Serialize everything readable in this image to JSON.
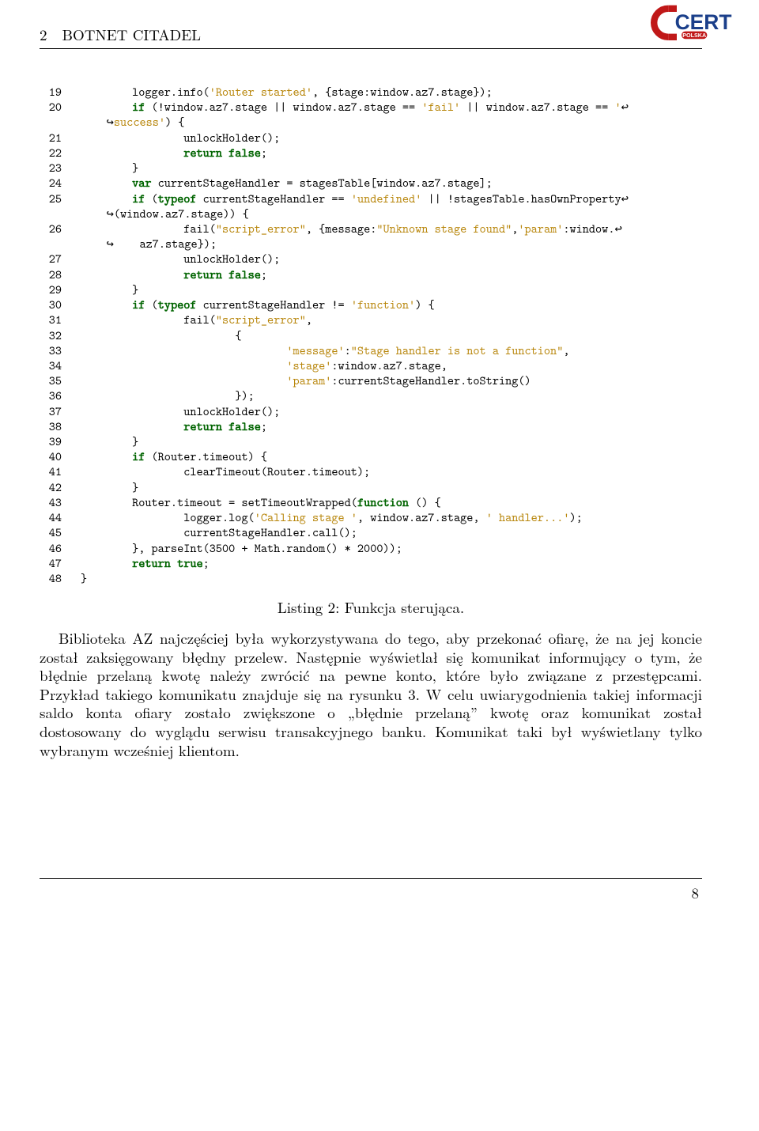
{
  "header": {
    "section_number": "2",
    "section_title": "BOTNET CITADEL",
    "logo_text_main": "CERT",
    "logo_text_sub": "POLSKA"
  },
  "code": {
    "lines": [
      {
        "n": 19,
        "seg": [
          [
            "id",
            "        logger.info("
          ],
          [
            "str",
            "'Router started'"
          ],
          [
            "id",
            ", {stage:window.az7.stage});"
          ]
        ]
      },
      {
        "n": 20,
        "seg": [
          [
            "id",
            "        "
          ],
          [
            "kw",
            "if"
          ],
          [
            "id",
            " (!window.az7.stage || window.az7.stage == "
          ],
          [
            "str",
            "'fail'"
          ],
          [
            "id",
            " || window.az7.stage == "
          ],
          [
            "str",
            "'"
          ]
        ],
        "wrap": true
      },
      {
        "n": 0,
        "cont": true,
        "seg": [
          [
            "str",
            "success'"
          ],
          [
            "id",
            ") {"
          ]
        ]
      },
      {
        "n": 21,
        "seg": [
          [
            "id",
            "                unlockHolder();"
          ]
        ]
      },
      {
        "n": 22,
        "seg": [
          [
            "id",
            "                "
          ],
          [
            "kw",
            "return"
          ],
          [
            "id",
            " "
          ],
          [
            "kw",
            "false"
          ],
          [
            "id",
            ";"
          ]
        ]
      },
      {
        "n": 23,
        "seg": [
          [
            "id",
            "        }"
          ]
        ]
      },
      {
        "n": 24,
        "seg": [
          [
            "id",
            "        "
          ],
          [
            "kw",
            "var"
          ],
          [
            "id",
            " currentStageHandler = stagesTable[window.az7.stage];"
          ]
        ]
      },
      {
        "n": 25,
        "seg": [
          [
            "id",
            "        "
          ],
          [
            "kw",
            "if"
          ],
          [
            "id",
            " ("
          ],
          [
            "kw",
            "typeof"
          ],
          [
            "id",
            " currentStageHandler == "
          ],
          [
            "str",
            "'undefined'"
          ],
          [
            "id",
            " || !stagesTable.hasOwnProperty"
          ]
        ],
        "wrap": true
      },
      {
        "n": 0,
        "cont": true,
        "seg": [
          [
            "id",
            "(window.az7.stage)) {"
          ]
        ]
      },
      {
        "n": 26,
        "seg": [
          [
            "id",
            "                fail("
          ],
          [
            "str",
            "\"script_error\""
          ],
          [
            "id",
            ", {message:"
          ],
          [
            "str",
            "\"Unknown stage found\""
          ],
          [
            "id",
            ","
          ],
          [
            "str",
            "'param'"
          ],
          [
            "id",
            ":window."
          ]
        ],
        "wrap": true
      },
      {
        "n": 0,
        "cont": true,
        "seg": [
          [
            "id",
            "    az7.stage});"
          ]
        ]
      },
      {
        "n": 27,
        "seg": [
          [
            "id",
            "                unlockHolder();"
          ]
        ]
      },
      {
        "n": 28,
        "seg": [
          [
            "id",
            "                "
          ],
          [
            "kw",
            "return"
          ],
          [
            "id",
            " "
          ],
          [
            "kw",
            "false"
          ],
          [
            "id",
            ";"
          ]
        ]
      },
      {
        "n": 29,
        "seg": [
          [
            "id",
            "        }"
          ]
        ]
      },
      {
        "n": 30,
        "seg": [
          [
            "id",
            "        "
          ],
          [
            "kw",
            "if"
          ],
          [
            "id",
            " ("
          ],
          [
            "kw",
            "typeof"
          ],
          [
            "id",
            " currentStageHandler != "
          ],
          [
            "str",
            "'function'"
          ],
          [
            "id",
            ") {"
          ]
        ]
      },
      {
        "n": 31,
        "seg": [
          [
            "id",
            "                fail("
          ],
          [
            "str",
            "\"script_error\""
          ],
          [
            "id",
            ","
          ]
        ]
      },
      {
        "n": 32,
        "seg": [
          [
            "id",
            "                        {"
          ]
        ]
      },
      {
        "n": 33,
        "seg": [
          [
            "id",
            "                                "
          ],
          [
            "str",
            "'message'"
          ],
          [
            "id",
            ":"
          ],
          [
            "str",
            "\"Stage handler is not a function\""
          ],
          [
            "id",
            ","
          ]
        ]
      },
      {
        "n": 34,
        "seg": [
          [
            "id",
            "                                "
          ],
          [
            "str",
            "'stage'"
          ],
          [
            "id",
            ":window.az7.stage,"
          ]
        ]
      },
      {
        "n": 35,
        "seg": [
          [
            "id",
            "                                "
          ],
          [
            "str",
            "'param'"
          ],
          [
            "id",
            ":currentStageHandler.toString()"
          ]
        ]
      },
      {
        "n": 36,
        "seg": [
          [
            "id",
            "                        });"
          ]
        ]
      },
      {
        "n": 37,
        "seg": [
          [
            "id",
            "                unlockHolder();"
          ]
        ]
      },
      {
        "n": 38,
        "seg": [
          [
            "id",
            "                "
          ],
          [
            "kw",
            "return"
          ],
          [
            "id",
            " "
          ],
          [
            "kw",
            "false"
          ],
          [
            "id",
            ";"
          ]
        ]
      },
      {
        "n": 39,
        "seg": [
          [
            "id",
            "        }"
          ]
        ]
      },
      {
        "n": 40,
        "seg": [
          [
            "id",
            "        "
          ],
          [
            "kw",
            "if"
          ],
          [
            "id",
            " (Router.timeout) {"
          ]
        ]
      },
      {
        "n": 41,
        "seg": [
          [
            "id",
            "                clearTimeout(Router.timeout);"
          ]
        ]
      },
      {
        "n": 42,
        "seg": [
          [
            "id",
            "        }"
          ]
        ]
      },
      {
        "n": 43,
        "seg": [
          [
            "id",
            "        Router.timeout = setTimeoutWrapped("
          ],
          [
            "kw",
            "function"
          ],
          [
            "id",
            " () {"
          ]
        ]
      },
      {
        "n": 44,
        "seg": [
          [
            "id",
            "                logger.log("
          ],
          [
            "str",
            "'Calling stage '"
          ],
          [
            "id",
            ", window.az7.stage, "
          ],
          [
            "str",
            "' handler...'"
          ],
          [
            "id",
            ");"
          ]
        ]
      },
      {
        "n": 45,
        "seg": [
          [
            "id",
            "                currentStageHandler.call();"
          ]
        ]
      },
      {
        "n": 46,
        "seg": [
          [
            "id",
            "        }, parseInt(3500 + Math.random() * 2000));"
          ]
        ]
      },
      {
        "n": 47,
        "seg": [
          [
            "id",
            "        "
          ],
          [
            "kw",
            "return"
          ],
          [
            "id",
            " "
          ],
          [
            "kw",
            "true"
          ],
          [
            "id",
            ";"
          ]
        ]
      },
      {
        "n": 48,
        "seg": [
          [
            "id",
            "}"
          ]
        ]
      }
    ]
  },
  "listing_caption": "Listing 2: Funkcja sterująca.",
  "body_paragraph": "Biblioteka AZ najczęściej była wykorzystywana do tego, aby przekonać ofiarę, że na jej koncie został zaksięgowany błędny przelew. Następnie wyświetlał się komunikat informujący o tym, że błędnie przelaną kwotę należy zwrócić na pewne konto, które było związane z przestępcami. Przykład takiego komunikatu znajduje się na rysunku 3. W celu uwiarygodnienia takiej informacji saldo konta ofiary zostało zwiększone o „błędnie przelaną” kwotę oraz komunikat został dostosowany do wyglądu serwisu transakcyjnego banku. Komunikat taki był wyświetlany tylko wybranym wcześniej klientom.",
  "page_number": "8"
}
